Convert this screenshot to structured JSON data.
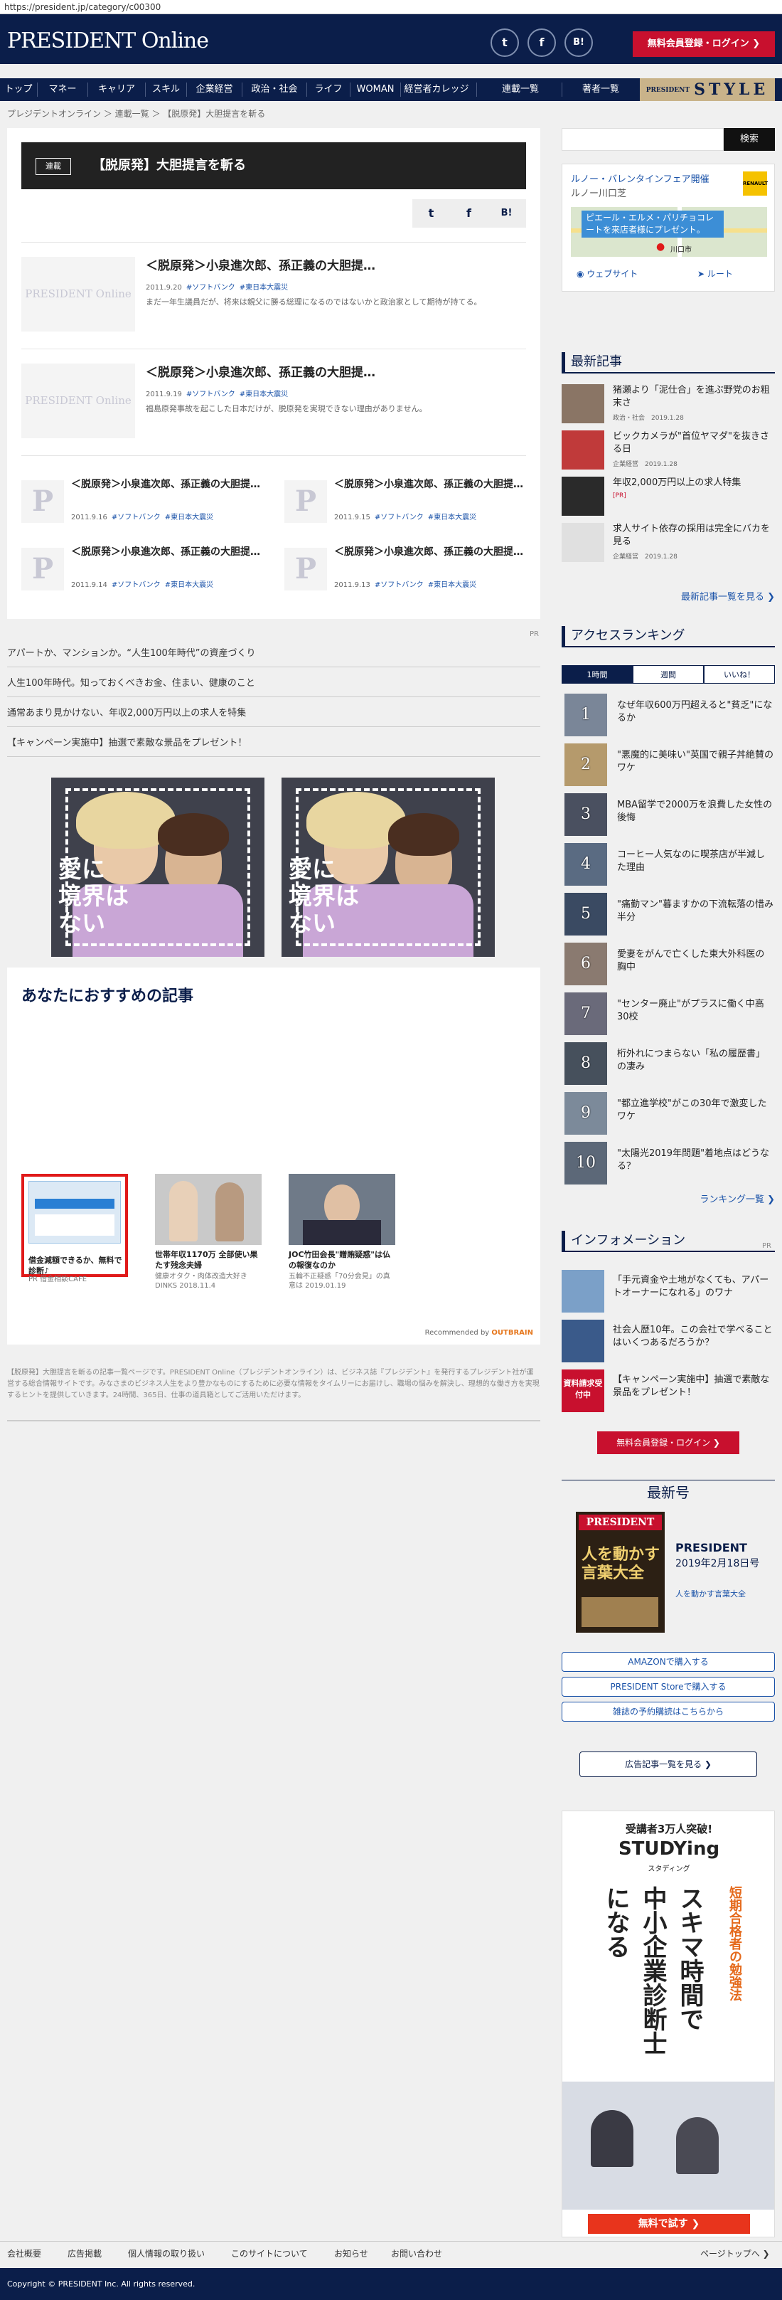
{
  "url": "https://president.jp/category/c00300",
  "header": {
    "logo": "PRESIDENT Online",
    "member_button": "無料会員登録・ログイン ❯",
    "social": [
      "t",
      "f",
      "B!"
    ]
  },
  "nav": {
    "items": [
      "トップ",
      "マネー",
      "キャリア",
      "スキル",
      "企業経営",
      "政治・社会",
      "ライフ",
      "WOMAN",
      "経営者カレッジ"
    ],
    "series": "連載一覧",
    "authors": "著者一覧",
    "style_label": "PRESIDENT",
    "style_word": "STYLE"
  },
  "breadcrumb": "プレジデントオンライン ＞ 連載一覧 ＞ 【脱原発】大胆提言を斬る",
  "series": {
    "tag": "連載",
    "title": "【脱原発】大胆提言を斬る",
    "share": [
      "t",
      "f",
      "B!"
    ]
  },
  "thumb_text": "PRESIDENT Online",
  "thumb_letter": "P",
  "big_articles": [
    {
      "title": "＜脱原発＞小泉進次郎、孫正義の大胆提…",
      "date": "2011.9.20",
      "tags": [
        "#ソフトバンク",
        "#東日本大震災"
      ],
      "desc": "まだ一年生議員だが、将来は親父に勝る総理になるのではないかと政治家として期待が持てる。"
    },
    {
      "title": "＜脱原発＞小泉進次郎、孫正義の大胆提…",
      "date": "2011.9.19",
      "tags": [
        "#ソフトバンク",
        "#東日本大震災"
      ],
      "desc": "福島原発事故を起こした日本だけが、脱原発を実現できない理由がありません。"
    }
  ],
  "small_articles": [
    {
      "title": "＜脱原発＞小泉進次郎、孫正義の大胆提…",
      "date": "2011.9.16",
      "tags": [
        "#ソフトバンク",
        "#東日本大震災"
      ]
    },
    {
      "title": "＜脱原発＞小泉進次郎、孫正義の大胆提…",
      "date": "2011.9.15",
      "tags": [
        "#ソフトバンク",
        "#東日本大震災"
      ]
    },
    {
      "title": "＜脱原発＞小泉進次郎、孫正義の大胆提…",
      "date": "2011.9.14",
      "tags": [
        "#ソフトバンク",
        "#東日本大震災"
      ]
    },
    {
      "title": "＜脱原発＞小泉進次郎、孫正義の大胆提…",
      "date": "2011.9.13",
      "tags": [
        "#ソフトバンク",
        "#東日本大震災"
      ]
    }
  ],
  "pr_label": "PR",
  "ad_links": [
    "アパートか、マンションか。“人生100年時代”の資産づくり",
    "人生100年時代。知っておくべきお金、住まい、健康のこと",
    "通常あまり見かけない、年収2,000万円以上の求人を特集",
    "【キャンペーン実施中】抽選で素敵な景品をプレゼント！"
  ],
  "banner_text": [
    "愛に",
    "境界は",
    "ない"
  ],
  "recommend": {
    "title": "あなたにおすすめの記事",
    "cards": [
      {
        "title": "借金減額できるか、無料で診断♪",
        "sub": "PR 借金相談CAFE"
      },
      {
        "title": "世帯年収1170万 全部使い果たす残念夫婦",
        "sub": "健康オタク・肉体改造大好きDINKS 2018.11.4"
      },
      {
        "title": "JOC竹田会長\"贈賄疑惑\"は仏の報復なのか",
        "sub": "五輪不正疑惑「70分会見」の真意は 2019.01.19"
      }
    ],
    "credit": "Recommended by",
    "credit_brand": "OUTBRAIN"
  },
  "footnote": "【脱原発】大胆提言を斬るの記事一覧ページです。PRESIDENT Online（プレジデントオンライン）は、ビジネス誌『プレジデント』を発行するプレジデント社が運営する総合情報サイトです。みなさまのビジネス人生をより豊かなものにするために必要な情報をタイムリーにお届けし、職場の悩みを解決し、理想的な働き方を実現するヒントを提供していきます。24時間、365日、仕事の道具箱としてご活用いただけます。",
  "sidebar": {
    "search_button": "検索",
    "map_ad": {
      "title": "ルノー・バレンタインフェア開催",
      "subtitle": "ルノー川口芝",
      "brand": "RENAULT",
      "bubble": "ピエール・エルメ・パリチョコレートを来店者様にプレゼント。",
      "city": "川口市",
      "website": "ウェブサイト",
      "route": "ルート"
    },
    "latest_title": "最新記事",
    "latest": [
      {
        "title": "猪瀬より「泥仕合」を進ぶ野党のお粗末さ",
        "cat": "政治・社会",
        "date": "2019.1.28"
      },
      {
        "title": "ビックカメラが\"首位ヤマダ\"を抜きさる日",
        "cat": "企業経営",
        "date": "2019.1.28"
      },
      {
        "title": "年収2,000万円以上の求人特集",
        "cat": "[PR]",
        "date": ""
      },
      {
        "title": "求人サイト依存の採用は完全にバカを見る",
        "cat": "企業経営",
        "date": "2019.1.28"
      }
    ],
    "latest_more": "最新記事一覧を見る ❯",
    "ranking_title": "アクセスランキング",
    "tabs": [
      "1時間",
      "週間",
      "いいね！"
    ],
    "ranking": [
      "なぜ年収600万円超えると\"貧乏\"になるか",
      "\"悪魔的に美味い\"英国で親子丼絶賛のワケ",
      "MBA留学で2000万を浪費した女性の後悔",
      "コーヒー人気なのに喫茶店が半減した理由",
      "\"痛勤マン\"暮ますかの下流転落の惜み半分",
      "愛妻をがんで亡くした東大外科医の胸中",
      "\"センター廃止\"がプラスに働く中高30校",
      "桁外れにつまらない「私の履歴書」の凄み",
      "\"都立進学校\"がこの30年で激変したワケ",
      "\"太陽光2019年問題\"着地点はどうなる？"
    ],
    "ranking_more": "ランキング一覧 ❯",
    "info_title": "インフォメーション",
    "info": [
      "「手元資金や土地がなくても、アパートオーナーになれる」のワナ",
      "社会人歴10年。この会社で学べることはいくつあるだろうか？",
      "【キャンペーン実施中】抽選で素敵な景品をプレゼント！"
    ],
    "info_badge": "資料請求受付中",
    "member_button": "無料会員登録・ログイン ❯",
    "latest_issue_title": "最新号",
    "magazine": {
      "name": "PRESIDENT",
      "date": "2019年2月18日号",
      "feature": "人を動かす言葉大全",
      "cover_title": "人を動かす言葉大全"
    },
    "buy_buttons": [
      "AMAZONで購入する",
      "PRESIDENT Storeで購入する",
      "雑誌の予約購読はこちらから"
    ],
    "ad_list_button": "広告記事一覧を見る ❯",
    "study_ad": {
      "top": "受講者3万人突破!",
      "brand": "STUDYing",
      "brand_sub": "スタディング",
      "v1": "スキマ時間で",
      "v2": "中小企業診断士",
      "v3": "になる",
      "side": "短期合格者の勉強法",
      "cta": "無料で試す ❯"
    }
  },
  "footer": {
    "links": [
      "会社概要",
      "広告掲載",
      "個人情報の取り扱い",
      "このサイトについて",
      "お知らせ",
      "お問い合わせ"
    ],
    "page_top": "ページトップへ ❯",
    "copyright": "Copyright © PRESIDENT Inc. All rights reserved."
  }
}
